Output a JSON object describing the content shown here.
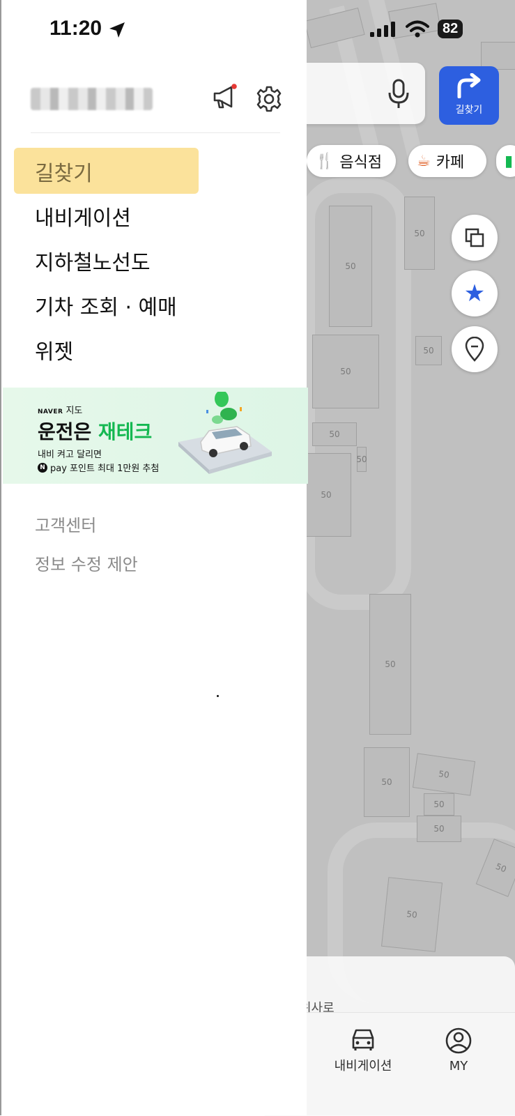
{
  "status_bar": {
    "time": "11:20",
    "battery": "82"
  },
  "drawer": {
    "menu": [
      {
        "label": "길찾기",
        "active": true
      },
      {
        "label": "내비게이션"
      },
      {
        "label": "지하철노선도"
      },
      {
        "label": "기차 조회 · 예매"
      },
      {
        "label": "위젯"
      }
    ],
    "banner": {
      "brand_logo": "NAVER",
      "brand_text": "지도",
      "headline_a": "운전은 ",
      "headline_b": "재테크",
      "sub1": "내비 켜고 달리면",
      "npay_badge": "N",
      "sub2": "pay 포인트 최대 1만원 추첨"
    },
    "footer_links": [
      "고객센터",
      "정보 수정 제안"
    ]
  },
  "map": {
    "route_button_label": "길찾기",
    "chips": [
      {
        "icon": "fork-knife-icon",
        "label": "음식점"
      },
      {
        "icon": "coffee-cup-icon",
        "label": "카페"
      }
    ],
    "block_label": "50",
    "road_label": "위사로",
    "tabs": [
      {
        "icon": "car-icon",
        "label": "내비게이션"
      },
      {
        "icon": "profile-icon",
        "label": "MY"
      }
    ]
  },
  "colors": {
    "highlight": "#fbe29b",
    "route_button": "#2d5fe0",
    "banner_green": "#14b851",
    "notification_dot": "#e53935"
  }
}
